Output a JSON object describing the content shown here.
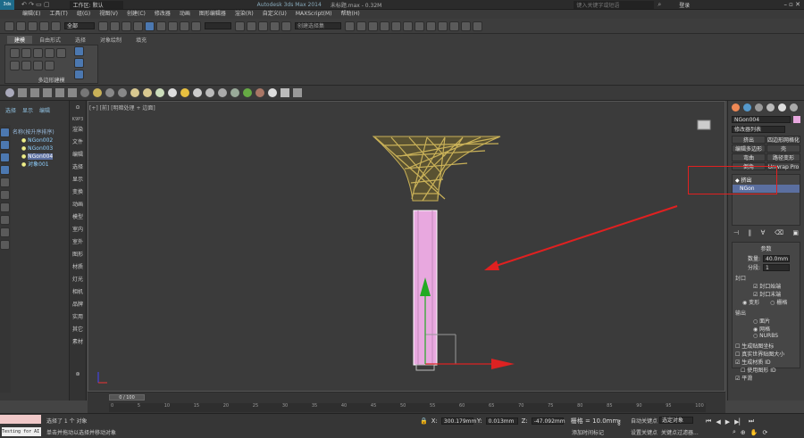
{
  "titlebar": {
    "workspace_label": "工作区: 默认",
    "app_title": "Autodesk 3ds Max 2014",
    "file_title": "未标题.max - 0.32M",
    "search_placeholder": "键入关键字或短语",
    "login": "登录"
  },
  "menu": [
    "编辑(E)",
    "工具(T)",
    "组(G)",
    "视图(V)",
    "创建(C)",
    "修改器",
    "动画",
    "图形编辑器",
    "渲染(R)",
    "自定义(U)",
    "MAXScript(M)",
    "帮助(H)"
  ],
  "toolbar": {
    "filter_select": "全部",
    "selection_set_placeholder": "创建选择集"
  },
  "ribbon": {
    "tabs": [
      "建模",
      "自由形式",
      "选择",
      "对象绘制",
      "填充"
    ],
    "panel_title": "多边形建模"
  },
  "scene_explorer": {
    "tabs": [
      "选择",
      "显示",
      "编辑"
    ],
    "header": "名称(按升序排序)",
    "items": [
      "NGon002",
      "NGon003",
      "NGon004",
      "对象001"
    ]
  },
  "left_commands": [
    "渲染",
    "文件",
    "编辑",
    "选择",
    "显示",
    "变换",
    "动画",
    "模型",
    "室内",
    "室外",
    "图形",
    "材质",
    "灯光",
    "相机",
    "品牌",
    "实用",
    "其它",
    "素材"
  ],
  "command_label": "K9P3",
  "viewport": {
    "label": "[+] [前] [明暗处理 + 边面]"
  },
  "command_panel": {
    "object_name": "NGon004",
    "modifier_list": "修改器列表",
    "buttons": [
      "挤出",
      "四边形网格化",
      "编辑多边形",
      "壳",
      "弯曲",
      "路径变形",
      "倒角",
      "Unwrap Pro"
    ],
    "stack": [
      "挤出",
      "NGon"
    ],
    "params_title": "参数",
    "amount_label": "数量:",
    "amount_value": "40.0mm",
    "segments_label": "分段:",
    "segments_value": "1",
    "cap_title": "封口",
    "cap_start": "封口始端",
    "cap_end": "封口末端",
    "morph": "变形",
    "grid": "栅格",
    "output_title": "输出",
    "patch": "面片",
    "mesh": "网格",
    "nurbs": "NURBS",
    "gen_map": "生成贴图坐标",
    "real_world": "真实世界贴图大小",
    "gen_mat": "生成材质 ID",
    "use_shape": "使用图形 ID",
    "smooth": "平滑"
  },
  "timeline": {
    "frame_label": "0 / 100",
    "ticks": [
      "0",
      "5",
      "10",
      "15",
      "20",
      "25",
      "30",
      "35",
      "40",
      "45",
      "50",
      "55",
      "60",
      "65",
      "70",
      "75",
      "80",
      "85",
      "90",
      "95",
      "100"
    ]
  },
  "statusbar": {
    "testing": "Testing for AI",
    "message1": "选择了 1 个 对象",
    "message2": "单击并拖动以选择并移动对象",
    "x_label": "X:",
    "x_value": "300.179mm",
    "y_label": "Y:",
    "y_value": "0.013mm",
    "z_label": "Z:",
    "z_value": "-47.092mm",
    "grid": "栅格 = 10.0mm",
    "add_key": "添加时间标记",
    "auto_key": "自动关键点",
    "selected": "选定对象",
    "set_key": "设置关键点",
    "key_filter": "关键点过滤器..."
  },
  "colors": {
    "annotation_red": "#e02020",
    "lamp_gold": "#c9b158",
    "pole_pink": "#e8a8df",
    "selection_blue": "#5b6fa0"
  }
}
